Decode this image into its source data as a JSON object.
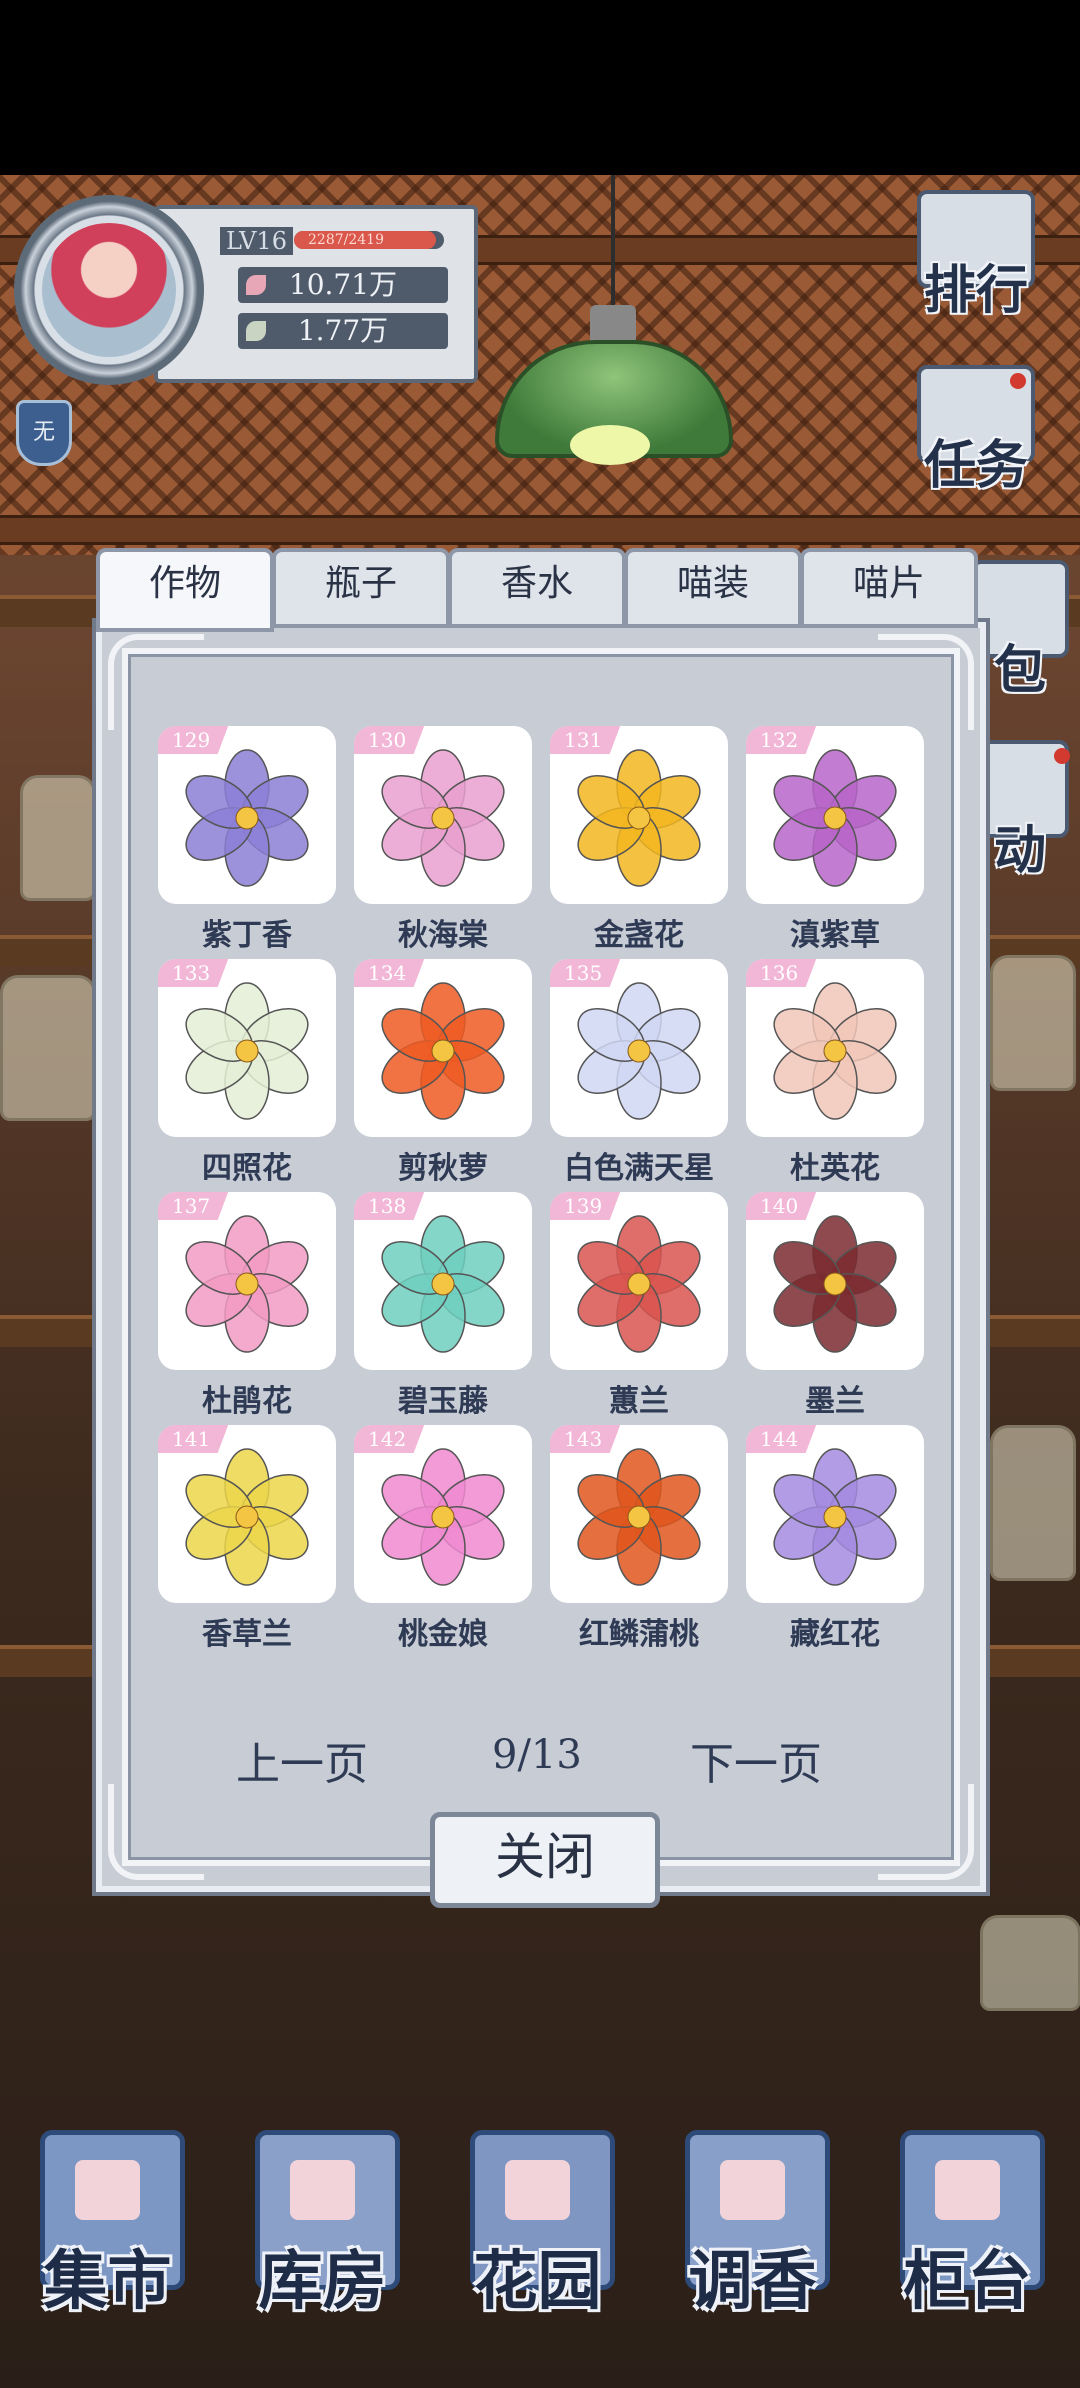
{
  "profile": {
    "level": "LV16",
    "xp": "2287/2419",
    "xp_fraction": 0.945,
    "stat1": "10.71万",
    "stat2": "1.77万",
    "badge": "无"
  },
  "side_buttons": [
    {
      "label": "排行",
      "icon": "ranking-icon"
    },
    {
      "label": "任务",
      "icon": "quest-icon"
    },
    {
      "label": "包",
      "icon": "bag-icon"
    },
    {
      "label": "动",
      "icon": "activity-icon"
    }
  ],
  "tabs": [
    {
      "label": "作物",
      "active": true
    },
    {
      "label": "瓶子",
      "active": false
    },
    {
      "label": "香水",
      "active": false
    },
    {
      "label": "喵装",
      "active": false
    },
    {
      "label": "喵片",
      "active": false
    }
  ],
  "items": [
    {
      "num": "129",
      "name": "紫丁香",
      "icon": "lilac-flower-icon",
      "color": "#8b7fd6"
    },
    {
      "num": "130",
      "name": "秋海棠",
      "icon": "begonia-flower-icon",
      "color": "#e9a0cf"
    },
    {
      "num": "131",
      "name": "金盏花",
      "icon": "calendula-flower-icon",
      "color": "#f2b620"
    },
    {
      "num": "132",
      "name": "滇紫草",
      "icon": "onosma-flower-icon",
      "color": "#b765c9"
    },
    {
      "num": "133",
      "name": "四照花",
      "icon": "dogwood-flower-icon",
      "color": "#e4efd6"
    },
    {
      "num": "134",
      "name": "剪秋萝",
      "icon": "lychnis-flower-icon",
      "color": "#ef5a22"
    },
    {
      "num": "135",
      "name": "白色满天星",
      "icon": "babys-breath-flower-icon",
      "color": "#cfd7f3"
    },
    {
      "num": "136",
      "name": "杜英花",
      "icon": "elaeocarpus-flower-icon",
      "color": "#f1c7b9"
    },
    {
      "num": "137",
      "name": "杜鹃花",
      "icon": "azalea-flower-icon",
      "color": "#f29bc3"
    },
    {
      "num": "138",
      "name": "碧玉藤",
      "icon": "jade-vine-flower-icon",
      "color": "#6fcfc0"
    },
    {
      "num": "139",
      "name": "蕙兰",
      "icon": "cymbidium-flower-icon",
      "color": "#d9534f"
    },
    {
      "num": "140",
      "name": "墨兰",
      "icon": "ink-orchid-flower-icon",
      "color": "#7a2a2f"
    },
    {
      "num": "141",
      "name": "香草兰",
      "icon": "vanilla-orchid-flower-icon",
      "color": "#ecd64a"
    },
    {
      "num": "142",
      "name": "桃金娘",
      "icon": "myrtle-flower-icon",
      "color": "#f08ad0"
    },
    {
      "num": "143",
      "name": "红鳞蒲桃",
      "icon": "syzygium-leaf-icon",
      "color": "#e0561c"
    },
    {
      "num": "144",
      "name": "藏红花",
      "icon": "crocus-flower-icon",
      "color": "#a58be0"
    }
  ],
  "pager": {
    "prev": "上一页",
    "page": "9/13",
    "next": "下一页"
  },
  "close_label": "关闭",
  "bottom_nav": [
    {
      "label": "集市",
      "icon": "market-icon"
    },
    {
      "label": "库房",
      "icon": "warehouse-icon"
    },
    {
      "label": "花园",
      "icon": "garden-rose-icon"
    },
    {
      "label": "调香",
      "icon": "perfume-blend-icon"
    },
    {
      "label": "柜台",
      "icon": "counter-icon"
    }
  ]
}
